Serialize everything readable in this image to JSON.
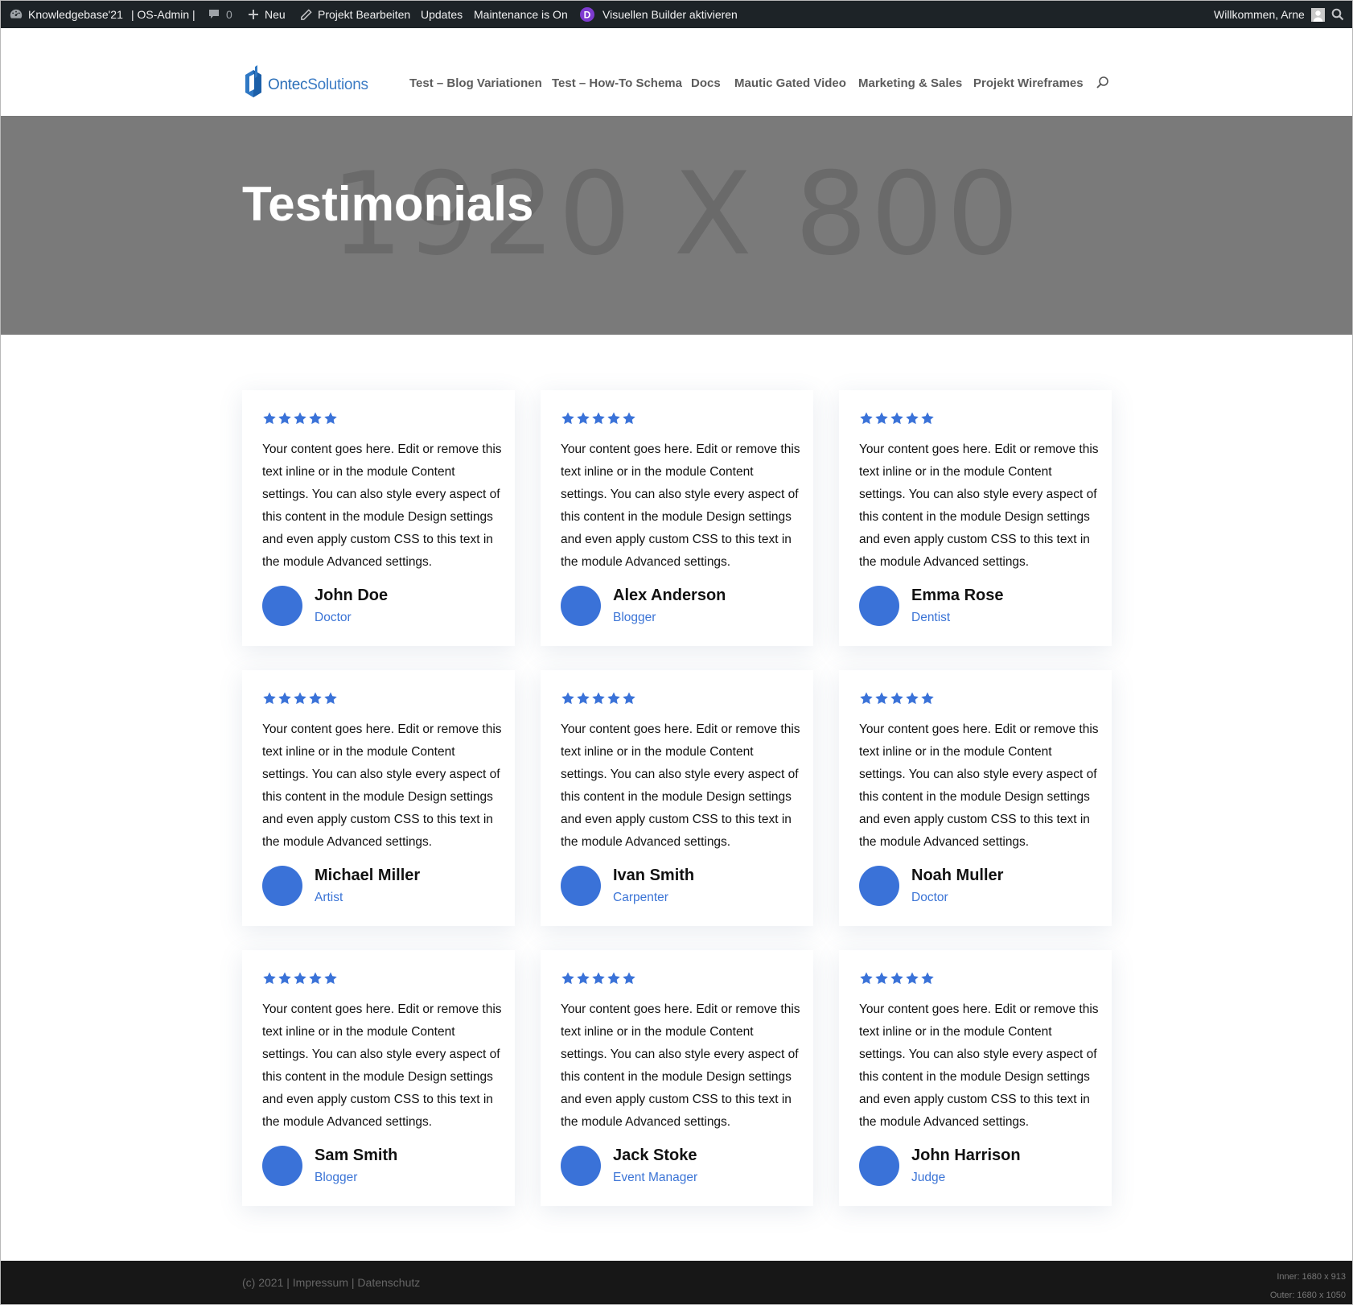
{
  "admin_bar": {
    "site_name": "Knowledgebase'21",
    "os_admin": "| OS-Admin |",
    "comments_count": "0",
    "new_label": "Neu",
    "edit_project": "Projekt Bearbeiten",
    "updates": "Updates",
    "maintenance": "Maintenance is On",
    "visual_builder": "Visuellen Builder aktivieren",
    "welcome": "Willkommen, Arne"
  },
  "header": {
    "logo_text_1": "Ontec",
    "logo_text_2": "Solutions",
    "nav": [
      "Test – Blog Variationen",
      "Test – How-To Schema",
      "Docs",
      "Mautic Gated Video",
      "Marketing & Sales",
      "Projekt Wireframes"
    ]
  },
  "hero": {
    "placeholder": "1920 X 800",
    "title": "Testimonials"
  },
  "testimonials": [
    {
      "rating": 5,
      "text": "Your content goes here. Edit or remove this text inline or in the module Content settings. You can also style every aspect of this content in the module Design settings and even apply custom CSS to this text in the module Advanced settings.",
      "name": "John Doe",
      "role": "Doctor"
    },
    {
      "rating": 5,
      "text": "Your content goes here. Edit or remove this text inline or in the module Content settings. You can also style every aspect of this content in the module Design settings and even apply custom CSS to this text in the module Advanced settings.",
      "name": "Alex Anderson",
      "role": "Blogger"
    },
    {
      "rating": 5,
      "text": "Your content goes here. Edit or remove this text inline or in the module Content settings. You can also style every aspect of this content in the module Design settings and even apply custom CSS to this text in the module Advanced settings.",
      "name": "Emma Rose",
      "role": "Dentist"
    },
    {
      "rating": 5,
      "text": "Your content goes here. Edit or remove this text inline or in the module Content settings. You can also style every aspect of this content in the module Design settings and even apply custom CSS to this text in the module Advanced settings.",
      "name": "Michael Miller",
      "role": "Artist"
    },
    {
      "rating": 5,
      "text": "Your content goes here. Edit or remove this text inline or in the module Content settings. You can also style every aspect of this content in the module Design settings and even apply custom CSS to this text in the module Advanced settings.",
      "name": "Ivan Smith",
      "role": "Carpenter"
    },
    {
      "rating": 5,
      "text": "Your content goes here. Edit or remove this text inline or in the module Content settings. You can also style every aspect of this content in the module Design settings and even apply custom CSS to this text in the module Advanced settings.",
      "name": "Noah Muller",
      "role": "Doctor"
    },
    {
      "rating": 5,
      "text": "Your content goes here. Edit or remove this text inline or in the module Content settings. You can also style every aspect of this content in the module Design settings and even apply custom CSS to this text in the module Advanced settings.",
      "name": "Sam Smith",
      "role": "Blogger"
    },
    {
      "rating": 5,
      "text": "Your content goes here. Edit or remove this text inline or in the module Content settings. You can also style every aspect of this content in the module Design settings and even apply custom CSS to this text in the module Advanced settings.",
      "name": "Jack Stoke",
      "role": "Event Manager"
    },
    {
      "rating": 5,
      "text": "Your content goes here. Edit or remove this text inline or in the module Content settings. You can also style every aspect of this content in the module Design settings and even apply custom CSS to this text in the module Advanced settings.",
      "name": "John Harrison",
      "role": "Judge"
    }
  ],
  "footer": {
    "copyright": "(c) 2021 | Impressum | Datenschutz",
    "inner_size": "Inner: 1680 x 913",
    "outer_size": "Outer: 1680 x 1050"
  },
  "colors": {
    "accent": "#3a72d8",
    "admin_bar": "#1d2327",
    "hero_bg": "#7a7a7a",
    "footer_bg": "#171717"
  },
  "icons": [
    "dashboard-icon",
    "comment-icon",
    "plus-icon",
    "pencil-icon",
    "divi-icon",
    "user-avatar-icon",
    "search-icon",
    "star-icon",
    "logo-icon"
  ]
}
